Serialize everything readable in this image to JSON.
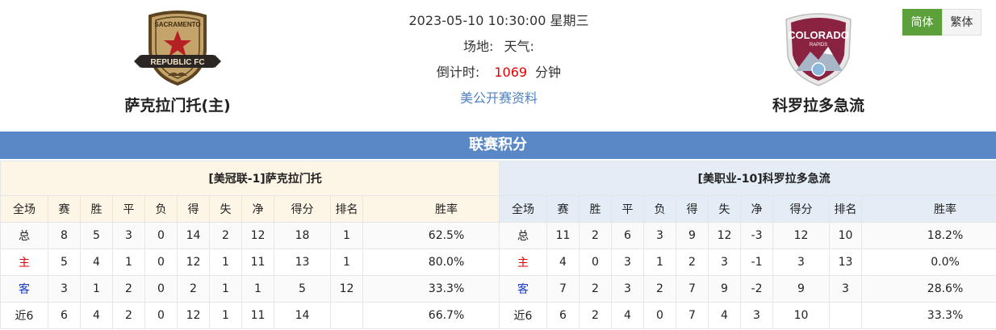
{
  "header": {
    "home_team": "萨克拉门托(主)",
    "away_team": "科罗拉多急流",
    "datetime": "2023-05-10 10:30:00 星期三",
    "venue_label": "场地:",
    "weather_label": "天气:",
    "countdown_label": "倒计时:",
    "countdown_value": "1069",
    "countdown_unit": "分钟",
    "info_link": "美公开赛资料",
    "home_logo": {
      "top_text": "SACRAMENTO",
      "banner_text": "REPUBLIC FC",
      "icon": "sacramento-republic-crest-icon",
      "colors": {
        "shield": "#c4a46b",
        "outline": "#5c4420",
        "star": "#b52025",
        "banner": "#2b2623"
      }
    },
    "away_logo": {
      "top_text": "COLORADO",
      "sub_text": "RAPIDS",
      "icon": "colorado-rapids-crest-icon",
      "colors": {
        "shield": "#8a2341",
        "mountain": "#a7b7c7",
        "snow": "#ffffff",
        "ball": "#8cb8de"
      }
    }
  },
  "lang": {
    "simplified": "简体",
    "traditional": "繁体",
    "active": "simplified"
  },
  "standings": {
    "title": "联赛积分",
    "columns": [
      "全场",
      "赛",
      "胜",
      "平",
      "负",
      "得",
      "失",
      "净",
      "得分",
      "排名",
      "胜率"
    ],
    "home": {
      "caption": "[美冠联-1]萨克拉门托",
      "rows": [
        [
          "总",
          "8",
          "5",
          "3",
          "0",
          "14",
          "2",
          "12",
          "18",
          "1",
          "62.5%"
        ],
        [
          "主",
          "5",
          "4",
          "1",
          "0",
          "12",
          "1",
          "11",
          "13",
          "1",
          "80.0%"
        ],
        [
          "客",
          "3",
          "1",
          "2",
          "0",
          "2",
          "1",
          "1",
          "5",
          "12",
          "33.3%"
        ],
        [
          "近6",
          "6",
          "4",
          "2",
          "0",
          "12",
          "1",
          "11",
          "14",
          "",
          "66.7%"
        ]
      ]
    },
    "away": {
      "caption": "[美职业-10]科罗拉多急流",
      "rows": [
        [
          "总",
          "11",
          "2",
          "6",
          "3",
          "9",
          "12",
          "-3",
          "12",
          "10",
          "18.2%"
        ],
        [
          "主",
          "4",
          "0",
          "3",
          "1",
          "2",
          "3",
          "-1",
          "3",
          "13",
          "0.0%"
        ],
        [
          "客",
          "7",
          "2",
          "3",
          "2",
          "7",
          "9",
          "-2",
          "9",
          "3",
          "28.6%"
        ],
        [
          "近6",
          "6",
          "2",
          "4",
          "0",
          "7",
          "4",
          "3",
          "10",
          "",
          "33.3%"
        ]
      ]
    }
  },
  "colors": {
    "section_bar": "#5a88c6",
    "home_panel_header": "#fdf5e5",
    "away_panel_header": "#e4edf6",
    "countdown": "#e30000",
    "link": "#4f82c2",
    "active_lang": "#5ca03c",
    "home_label": "#e30000",
    "away_label": "#1a3cbf"
  }
}
